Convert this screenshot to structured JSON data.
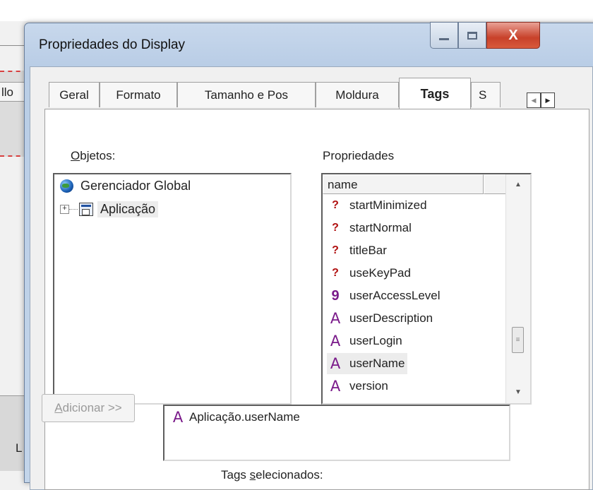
{
  "background": {
    "partial_tab_label": "llo",
    "partial_lower_label": "L"
  },
  "dialog": {
    "title": "Propriedades do Display",
    "close_glyph": "X"
  },
  "tabs": [
    {
      "label": "Geral"
    },
    {
      "label": "Formato"
    },
    {
      "label": "Tamanho e Pos"
    },
    {
      "label": "Moldura"
    },
    {
      "label": "Tags",
      "active": true
    },
    {
      "label": "S"
    }
  ],
  "objects": {
    "label_prefix": "O",
    "label_rest": "bjetos:",
    "items": [
      {
        "label": "Gerenciador Global",
        "icon": "globe-icon"
      },
      {
        "label": "Aplicação",
        "icon": "application-icon",
        "expander": "+"
      }
    ]
  },
  "properties": {
    "label": "Propriedades",
    "column_header": "name",
    "items": [
      {
        "label": "startMinimized",
        "icon": "question-icon",
        "glyph": "?"
      },
      {
        "label": "startNormal",
        "icon": "question-icon",
        "glyph": "?"
      },
      {
        "label": "titleBar",
        "icon": "question-icon",
        "glyph": "?"
      },
      {
        "label": "useKeyPad",
        "icon": "question-icon",
        "glyph": "?"
      },
      {
        "label": "userAccessLevel",
        "icon": "number-icon",
        "glyph": "9"
      },
      {
        "label": "userDescription",
        "icon": "string-icon",
        "glyph": "A"
      },
      {
        "label": "userLogin",
        "icon": "string-icon",
        "glyph": "A"
      },
      {
        "label": "userName",
        "icon": "string-icon",
        "glyph": "A",
        "selected": true
      },
      {
        "label": "version",
        "icon": "string-icon",
        "glyph": "A"
      }
    ]
  },
  "selected_tags": {
    "label_prefix": "Tags ",
    "label_u": "s",
    "label_rest": "elecionados:",
    "items": [
      {
        "label": "Aplicação.userName",
        "glyph": "A"
      }
    ]
  },
  "add_button": {
    "label_u": "A",
    "label_rest": "dicionar >>"
  },
  "colors": {
    "tag_icon": "#7a1a8a",
    "bool_icon": "#b01010",
    "title_bar": "#b9cde6"
  }
}
